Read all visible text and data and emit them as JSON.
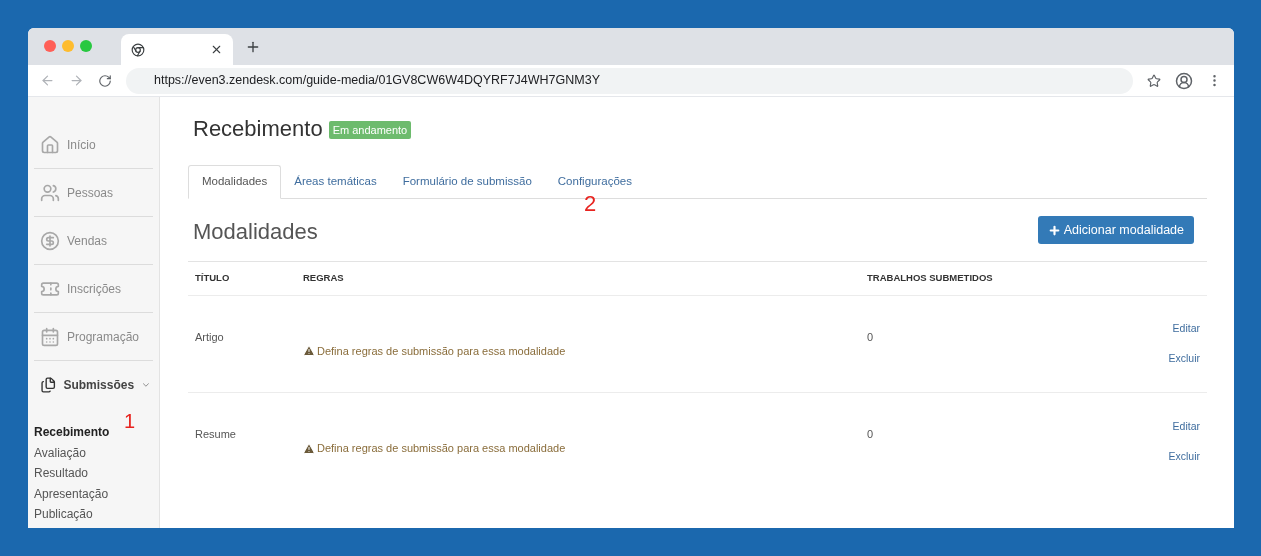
{
  "browser": {
    "url": "https://even3.zendesk.com/guide-media/01GV8CW6W4DQYRF7J4WH7GNM3Y"
  },
  "sidebar": {
    "items": [
      {
        "label": "Início"
      },
      {
        "label": "Pessoas"
      },
      {
        "label": "Vendas"
      },
      {
        "label": "Inscrições"
      },
      {
        "label": "Programação"
      },
      {
        "label": "Submissões",
        "expanded": true,
        "children": [
          {
            "label": "Recebimento",
            "selected": true
          },
          {
            "label": "Avaliação",
            "selected": false
          },
          {
            "label": "Resultado",
            "selected": false
          },
          {
            "label": "Apresentação",
            "selected": false
          },
          {
            "label": "Publicação",
            "selected": false
          }
        ]
      }
    ]
  },
  "page": {
    "title": "Recebimento",
    "status_badge": "Em andamento"
  },
  "tabs": [
    {
      "label": "Modalidades",
      "selected": true
    },
    {
      "label": "Áreas temáticas",
      "selected": false
    },
    {
      "label": "Formulário de submissão",
      "selected": false
    },
    {
      "label": "Configurações",
      "selected": false
    }
  ],
  "section": {
    "heading": "Modalidades",
    "add_button": "Adicionar modalidade"
  },
  "table": {
    "columns": [
      "TÍTULO",
      "REGRAS",
      "TRABALHOS SUBMETIDOS"
    ],
    "rows": [
      {
        "title": "Artigo",
        "rule_warning": "Defina regras de submissão para essa modalidade",
        "submitted": "0",
        "actions": [
          "Editar",
          "Excluir"
        ]
      },
      {
        "title": "Resume",
        "rule_warning": "Defina regras de submissão para essa modalidade",
        "submitted": "0",
        "actions": [
          "Editar",
          "Excluir"
        ]
      }
    ]
  },
  "annotations": [
    "1",
    "2"
  ]
}
